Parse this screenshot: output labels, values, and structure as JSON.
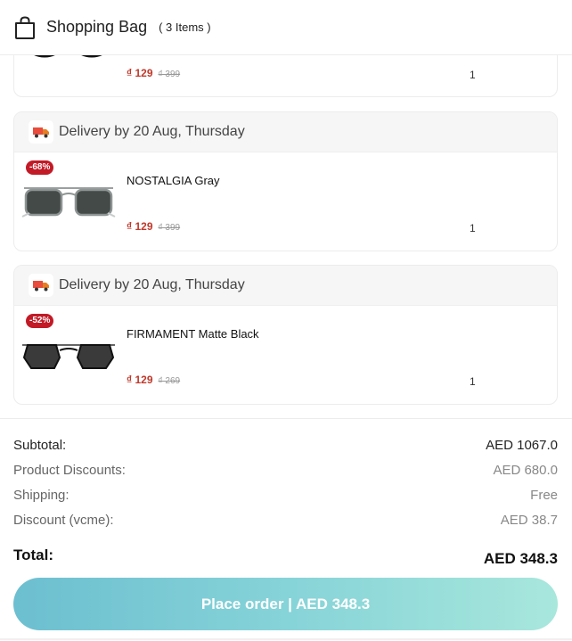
{
  "header": {
    "icon": "shopping-bag-icon",
    "title": "Shopping Bag",
    "count": "( 3 Items )"
  },
  "cart": {
    "items": [
      {
        "delivery": "",
        "badge": "",
        "name": "",
        "price": "₫ 129",
        "old_price": "₫ 399",
        "qty": "1"
      },
      {
        "delivery": "Delivery by 20 Aug, Thursday",
        "badge": "-68%",
        "name": "NOSTALGIA Gray",
        "price": "₫ 129",
        "old_price": "₫ 399",
        "qty": "1"
      },
      {
        "delivery": "Delivery by 20 Aug, Thursday",
        "badge": "-52%",
        "name": "FIRMAMENT Matte Black",
        "price": "₫ 129",
        "old_price": "₫ 269",
        "qty": "1"
      }
    ]
  },
  "summary": {
    "subtotal_label": "Subtotal:",
    "subtotal_value": "AED 1067.0",
    "product_discounts_label": "Product Discounts:",
    "product_discounts_value": "AED 680.0",
    "shipping_label": "Shipping:",
    "shipping_value": "Free",
    "discount_label": "Discount (vcme):",
    "discount_value": "AED 38.7",
    "total_label": "Total:",
    "total_value": "AED 348.3"
  },
  "actions": {
    "place_order": "Place order | AED 348.3"
  },
  "colors": {
    "price_red": "#c0392b",
    "badge_red": "#c21a26",
    "button_start": "#6cbfd0",
    "button_end": "#a8e7dc"
  }
}
